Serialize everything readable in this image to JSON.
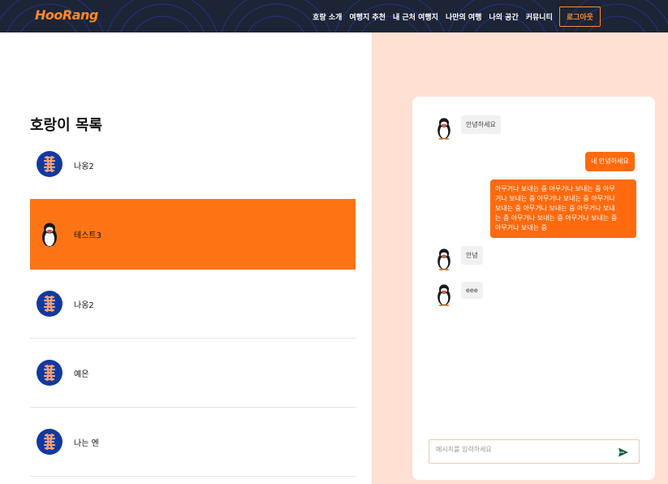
{
  "header": {
    "logo": "HooRang",
    "nav": [
      "호랑 소개",
      "여행지 추천",
      "내 근처 여행지",
      "나만의 여행",
      "나의 공간",
      "커뮤니티"
    ],
    "logout_label": "로그아웃"
  },
  "list": {
    "title": "호랑이 목록",
    "items": [
      {
        "name": "나옹2",
        "avatar": "tiger-icon"
      },
      {
        "name": "테스트3",
        "avatar": "penguin-icon"
      },
      {
        "name": "나옹2",
        "avatar": "tiger-icon"
      },
      {
        "name": "예은",
        "avatar": "tiger-icon"
      },
      {
        "name": "나는 엔",
        "avatar": "tiger-icon"
      }
    ]
  },
  "chat": {
    "messages": [
      {
        "side": "left",
        "text": "안녕하세요"
      },
      {
        "side": "right",
        "text": "네 안녕하세요"
      },
      {
        "side": "right",
        "lines": [
          "아무거나 보내는 중 아무거나 보내는 중 아무",
          "거나 보내는 중 아무거나 보내는 중 아무거나",
          "보내는 중 아무거나 보내는 중 아무거나 보내",
          "는 중 아무거나 보내는 중 아무거나 보내는 중",
          "아무거나 보내는 중"
        ]
      },
      {
        "side": "left",
        "text": "안녕"
      },
      {
        "side": "left",
        "text": "eee"
      }
    ],
    "input_placeholder": "메시지를 입력하세요"
  },
  "colors": {
    "accent": "#fd7414",
    "bubble_out": "#ff6a0e",
    "header_bg": "#1c2436",
    "right_bg": "#ffe0d2",
    "tiger_bg": "#1239a0"
  }
}
